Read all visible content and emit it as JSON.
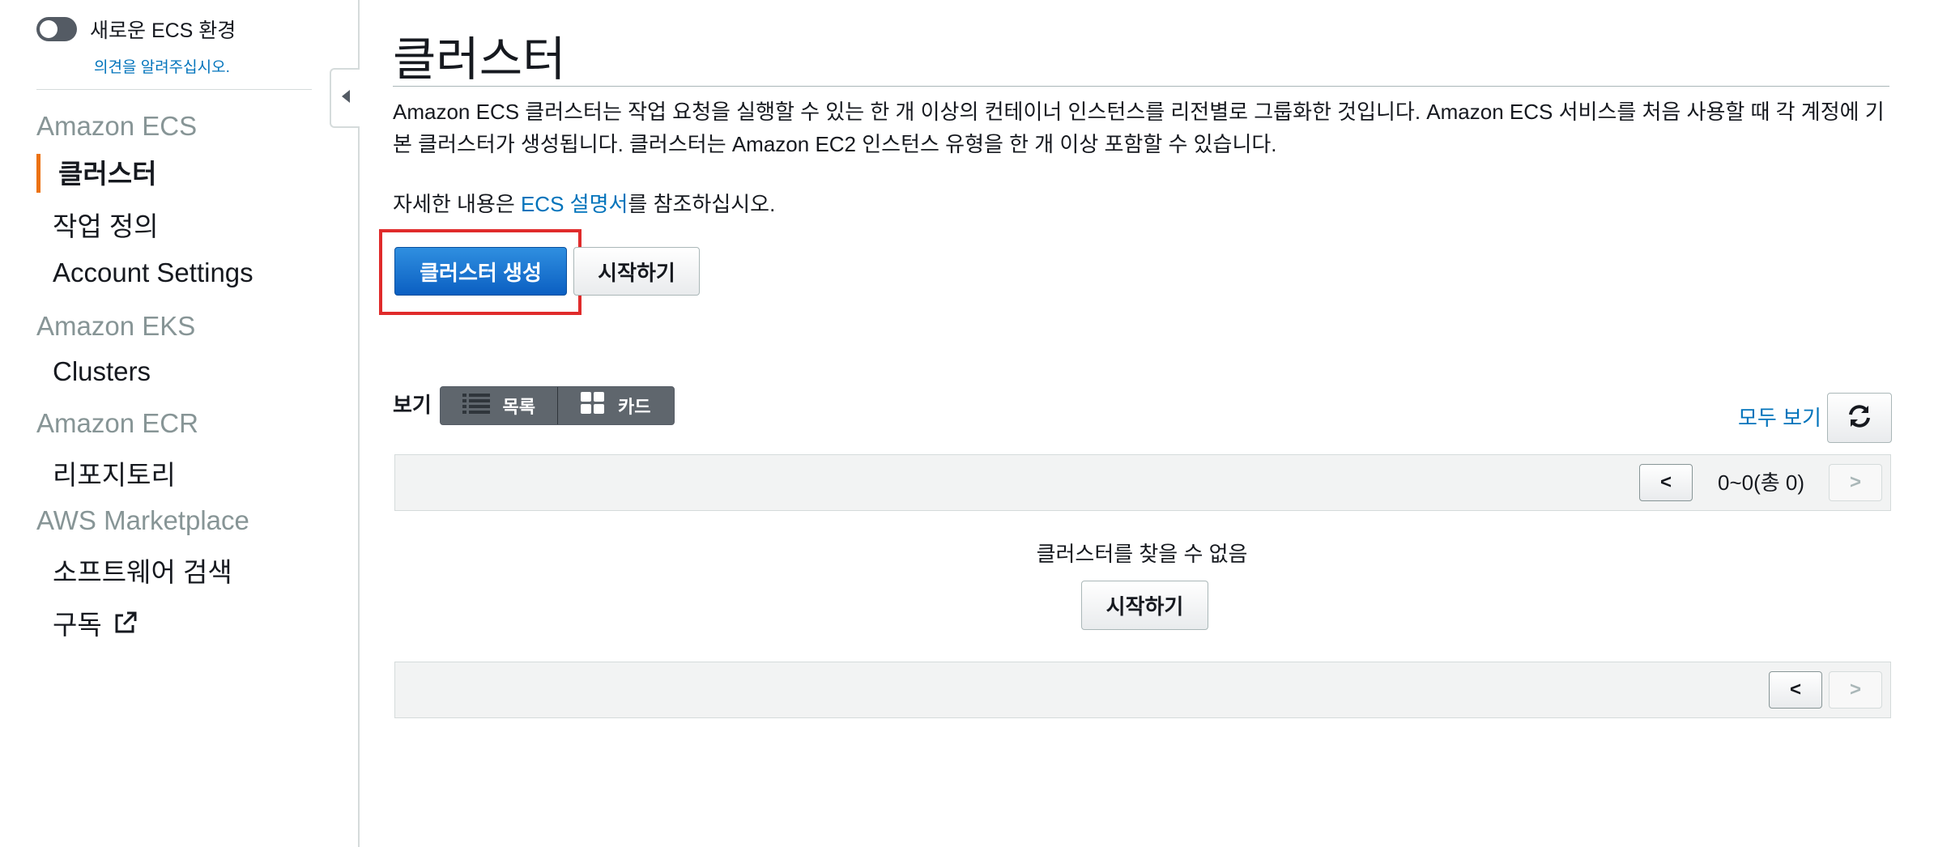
{
  "sidebar": {
    "toggle_label": "새로운 ECS 환경",
    "feedback_link": "의견을 알려주십시오.",
    "sections": [
      {
        "title": "Amazon ECS",
        "items": [
          "클러스터",
          "작업 정의",
          "Account Settings"
        ]
      },
      {
        "title": "Amazon EKS",
        "items": [
          "Clusters"
        ]
      },
      {
        "title": "Amazon ECR",
        "items": [
          "리포지토리"
        ]
      },
      {
        "title": "AWS Marketplace",
        "items": [
          "소프트웨어 검색",
          "구독"
        ]
      }
    ]
  },
  "main": {
    "title": "클러스터",
    "description": "Amazon ECS 클러스터는 작업 요청을 실행할 수 있는 한 개 이상의 컨테이너 인스턴스를 리전별로 그룹화한 것입니다. Amazon ECS 서비스를 처음 사용할 때 각 계정에 기본 클러스터가 생성됩니다. 클러스터는 Amazon EC2 인스턴스 유형을 한 개 이상 포함할 수 있습니다.",
    "more_info_prefix": "자세한 내용은 ",
    "more_info_link": "ECS 설명서",
    "more_info_suffix": "를 참조하십시오.",
    "create_button": "클러스터 생성",
    "start_button": "시작하기",
    "view_label": "보기",
    "view_list": "목록",
    "view_card": "카드",
    "view_all": "모두 보기",
    "pagination_text": "0~0(총 0)",
    "prev_symbol": "<",
    "next_symbol": ">",
    "empty_message": "클러스터를 찾을 수 없음",
    "empty_start_button": "시작하기"
  },
  "colors": {
    "accent_bar": "#ec7211",
    "link": "#0073bb",
    "primary_button": "#0b5fc2",
    "highlight": "#e02b2b"
  }
}
